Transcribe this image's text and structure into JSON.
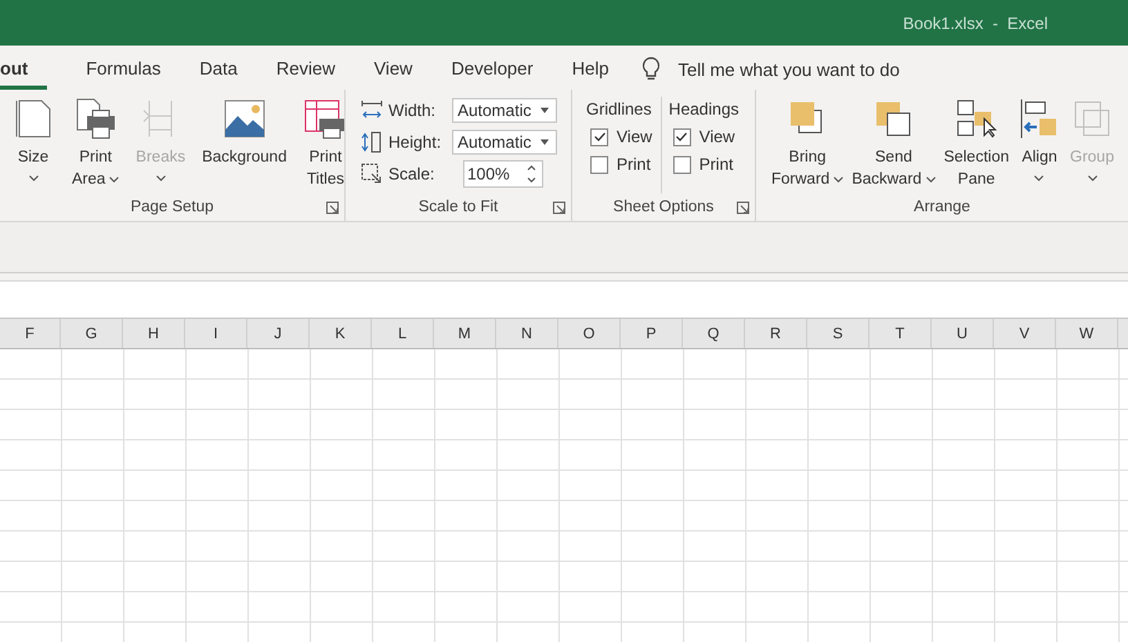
{
  "window": {
    "title": "Book1.xlsx  -  Excel"
  },
  "tabs": [
    {
      "label": "out",
      "selected": true
    },
    {
      "label": "Formulas",
      "selected": false
    },
    {
      "label": "Data",
      "selected": false
    },
    {
      "label": "Review",
      "selected": false
    },
    {
      "label": "View",
      "selected": false
    },
    {
      "label": "Developer",
      "selected": false
    },
    {
      "label": "Help",
      "selected": false
    }
  ],
  "search": {
    "placeholder": "Tell me what you want to do"
  },
  "ribbon": {
    "groups": [
      {
        "kind": "buttons",
        "label": "Page Setup",
        "launcher": true,
        "buttons": [
          {
            "kind": "size",
            "lines": [
              "Size"
            ],
            "caret": true,
            "disabled": false
          },
          {
            "kind": "print-area",
            "lines": [
              "Print",
              "Area"
            ],
            "caret": true,
            "disabled": false
          },
          {
            "kind": "breaks",
            "lines": [
              "Breaks"
            ],
            "caret": true,
            "disabled": true
          },
          {
            "kind": "background",
            "lines": [
              "Background"
            ],
            "caret": false,
            "disabled": false
          },
          {
            "kind": "print-titles",
            "lines": [
              "Print",
              "Titles"
            ],
            "caret": false,
            "disabled": false
          }
        ]
      },
      {
        "kind": "fields",
        "label": "Scale to Fit",
        "launcher": true,
        "fields": [
          {
            "kind": "dropdown",
            "label": "Width:",
            "value": "Automatic"
          },
          {
            "kind": "dropdown",
            "label": "Height:",
            "value": "Automatic"
          },
          {
            "kind": "spinner",
            "label": "Scale:",
            "value": "100%"
          }
        ]
      },
      {
        "kind": "options",
        "label": "Sheet Options",
        "launcher": true,
        "columns": [
          {
            "heading": "Gridlines",
            "boxes": [
              {
                "label": "View",
                "checked": true
              },
              {
                "label": "Print",
                "checked": false
              }
            ]
          },
          {
            "heading": "Headings",
            "boxes": [
              {
                "label": "View",
                "checked": true
              },
              {
                "label": "Print",
                "checked": false
              }
            ]
          }
        ]
      },
      {
        "kind": "buttons",
        "label": "Arrange",
        "launcher": false,
        "buttons": [
          {
            "kind": "bring-forward",
            "lines": [
              "Bring",
              "Forward"
            ],
            "caret": true,
            "disabled": false
          },
          {
            "kind": "send-backward",
            "lines": [
              "Send",
              "Backward"
            ],
            "caret": true,
            "disabled": false
          },
          {
            "kind": "selection-pane",
            "lines": [
              "Selection",
              "Pane"
            ],
            "caret": false,
            "disabled": false
          },
          {
            "kind": "align",
            "lines": [
              "Align"
            ],
            "caret": true,
            "disabled": false
          },
          {
            "kind": "group",
            "lines": [
              "Group"
            ],
            "caret": true,
            "disabled": true
          }
        ]
      }
    ]
  },
  "sheet": {
    "columns": [
      "F",
      "G",
      "H",
      "I",
      "J",
      "K",
      "L",
      "M",
      "N",
      "O",
      "P",
      "Q",
      "R",
      "S",
      "T",
      "U",
      "V",
      "W"
    ]
  }
}
